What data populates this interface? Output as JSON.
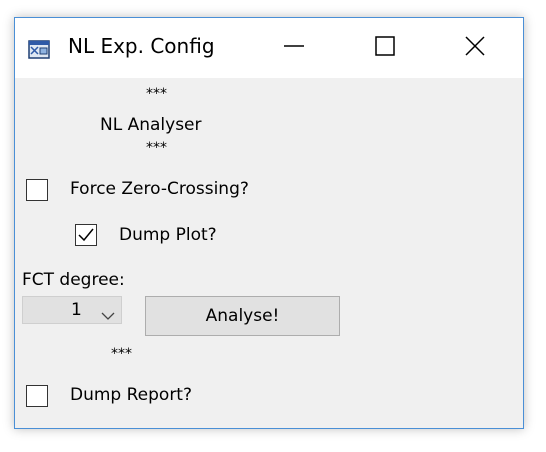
{
  "window": {
    "title": "NL Exp. Config",
    "icon": "app-window-icon",
    "controls": [
      "minimize-icon",
      "maximize-icon",
      "close-icon"
    ]
  },
  "content": {
    "stars_top": "***",
    "heading": "NL Analyser",
    "stars_below_heading": "***",
    "force_zero_crossing": {
      "label": "Force Zero-Crossing?",
      "checked": false
    },
    "dump_plot": {
      "label": "Dump Plot?",
      "checked": true
    },
    "fct_degree": {
      "label": "FCT degree:",
      "selected": "1"
    },
    "analyse_button": "Analyse!",
    "stars_bottom": "***",
    "dump_report": {
      "label": "Dump Report?",
      "checked": false
    }
  },
  "colors": {
    "window_border": "#4a8fd6",
    "client_background": "#f0f0f0",
    "button_face": "#e1e1e1"
  }
}
